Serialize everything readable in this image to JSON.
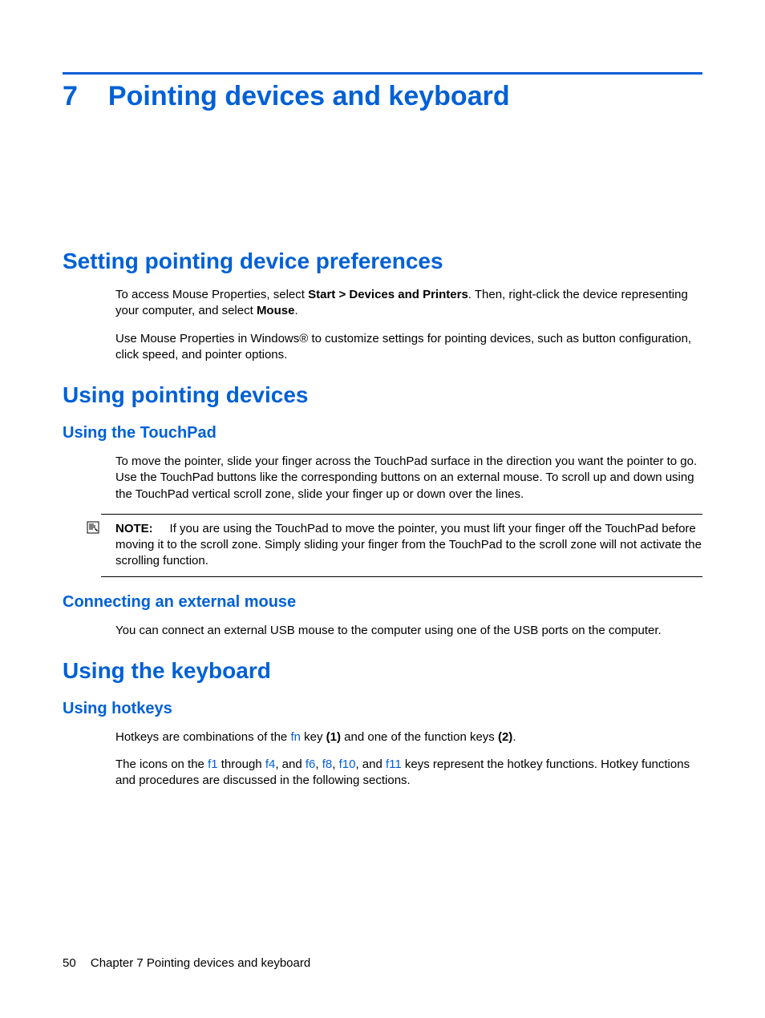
{
  "chapter": {
    "number": "7",
    "title": "Pointing devices and keyboard"
  },
  "sections": {
    "s1": {
      "title": "Setting pointing device preferences",
      "p1_a": "To access Mouse Properties, select ",
      "p1_b": "Start > Devices and Printers",
      "p1_c": ". Then, right-click the device representing your computer, and select ",
      "p1_d": "Mouse",
      "p1_e": ".",
      "p2": "Use Mouse Properties in Windows® to customize settings for pointing devices, such as button configuration, click speed, and pointer options."
    },
    "s2": {
      "title": "Using pointing devices",
      "sub1": {
        "title": "Using the TouchPad",
        "p1": "To move the pointer, slide your finger across the TouchPad surface in the direction you want the pointer to go. Use the TouchPad buttons like the corresponding buttons on an external mouse. To scroll up and down using the TouchPad vertical scroll zone, slide your finger up or down over the lines.",
        "note_label": "NOTE:",
        "note_body": "If you are using the TouchPad to move the pointer, you must lift your finger off the TouchPad before moving it to the scroll zone. Simply sliding your finger from the TouchPad to the scroll zone will not activate the scrolling function."
      },
      "sub2": {
        "title": "Connecting an external mouse",
        "p1": "You can connect an external USB mouse to the computer using one of the USB ports on the computer."
      }
    },
    "s3": {
      "title": "Using the keyboard",
      "sub1": {
        "title": "Using hotkeys",
        "p1_a": "Hotkeys are combinations of the ",
        "p1_fn": "fn",
        "p1_b": " key ",
        "p1_c": "(1)",
        "p1_d": " and one of the function keys ",
        "p1_e": "(2)",
        "p1_f": ".",
        "p2_a": "The icons on the ",
        "p2_f1": "f1",
        "p2_b": " through ",
        "p2_f4": "f4",
        "p2_c": ", and ",
        "p2_f6": "f6",
        "p2_d": ", ",
        "p2_f8": "f8",
        "p2_e": ", ",
        "p2_f10": "f10",
        "p2_f": ", and ",
        "p2_f11": "f11",
        "p2_g": " keys represent the hotkey functions. Hotkey functions and procedures are discussed in the following sections."
      }
    }
  },
  "footer": {
    "page": "50",
    "chapter_label": "Chapter 7   Pointing devices and keyboard"
  }
}
